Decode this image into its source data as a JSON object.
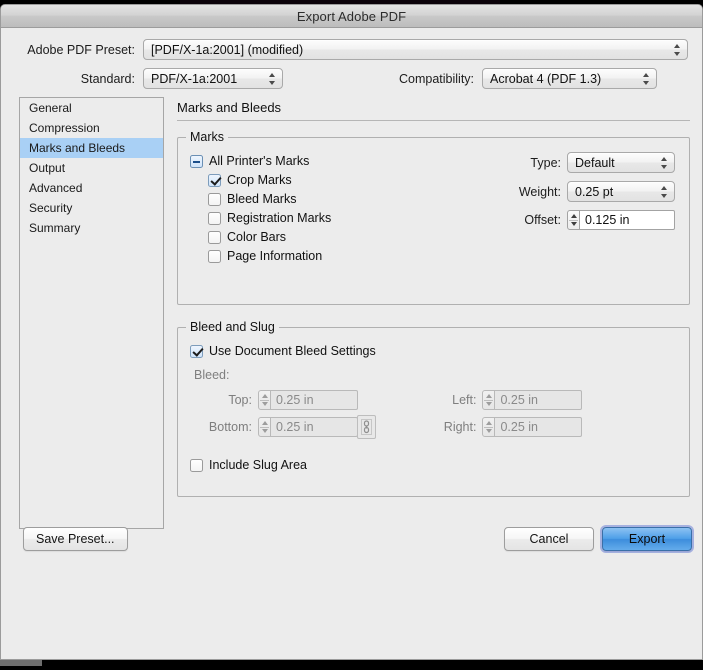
{
  "window": {
    "title": "Export Adobe PDF"
  },
  "top": {
    "preset_label": "Adobe PDF Preset:",
    "preset_value": "[PDF/X-1a:2001] (modified)",
    "standard_label": "Standard:",
    "standard_value": "PDF/X-1a:2001",
    "compatibility_label": "Compatibility:",
    "compatibility_value": "Acrobat 4 (PDF 1.3)"
  },
  "sidebar": {
    "items": [
      {
        "label": "General",
        "selected": false
      },
      {
        "label": "Compression",
        "selected": false
      },
      {
        "label": "Marks and Bleeds",
        "selected": true
      },
      {
        "label": "Output",
        "selected": false
      },
      {
        "label": "Advanced",
        "selected": false
      },
      {
        "label": "Security",
        "selected": false
      },
      {
        "label": "Summary",
        "selected": false
      }
    ]
  },
  "pane": {
    "title": "Marks and Bleeds",
    "marks": {
      "legend": "Marks",
      "checkboxes": [
        {
          "label": "All Printer's Marks",
          "state": "mixed"
        },
        {
          "label": "Crop Marks",
          "state": "checked"
        },
        {
          "label": "Bleed Marks",
          "state": "unchecked"
        },
        {
          "label": "Registration Marks",
          "state": "unchecked"
        },
        {
          "label": "Color Bars",
          "state": "unchecked"
        },
        {
          "label": "Page Information",
          "state": "unchecked"
        }
      ],
      "type_label": "Type:",
      "type_value": "Default",
      "weight_label": "Weight:",
      "weight_value": "0.25 pt",
      "offset_label": "Offset:",
      "offset_value": "0.125 in"
    },
    "bleed": {
      "legend": "Bleed and Slug",
      "use_document_label": "Use Document Bleed Settings",
      "use_document_state": "checked",
      "bleed_label": "Bleed:",
      "top_label": "Top:",
      "top_value": "0.25 in",
      "bottom_label": "Bottom:",
      "bottom_value": "0.25 in",
      "left_label": "Left:",
      "left_value": "0.25 in",
      "right_label": "Right:",
      "right_value": "0.25 in",
      "link_icon": "chain-link-icon",
      "slug_label": "Include Slug Area",
      "slug_state": "unchecked"
    }
  },
  "footer": {
    "save_preset": "Save Preset...",
    "cancel": "Cancel",
    "export": "Export"
  },
  "colors": {
    "selection": "#a9d0f5",
    "default_button": "#4e9fe8",
    "window_bg": "#ececec"
  }
}
